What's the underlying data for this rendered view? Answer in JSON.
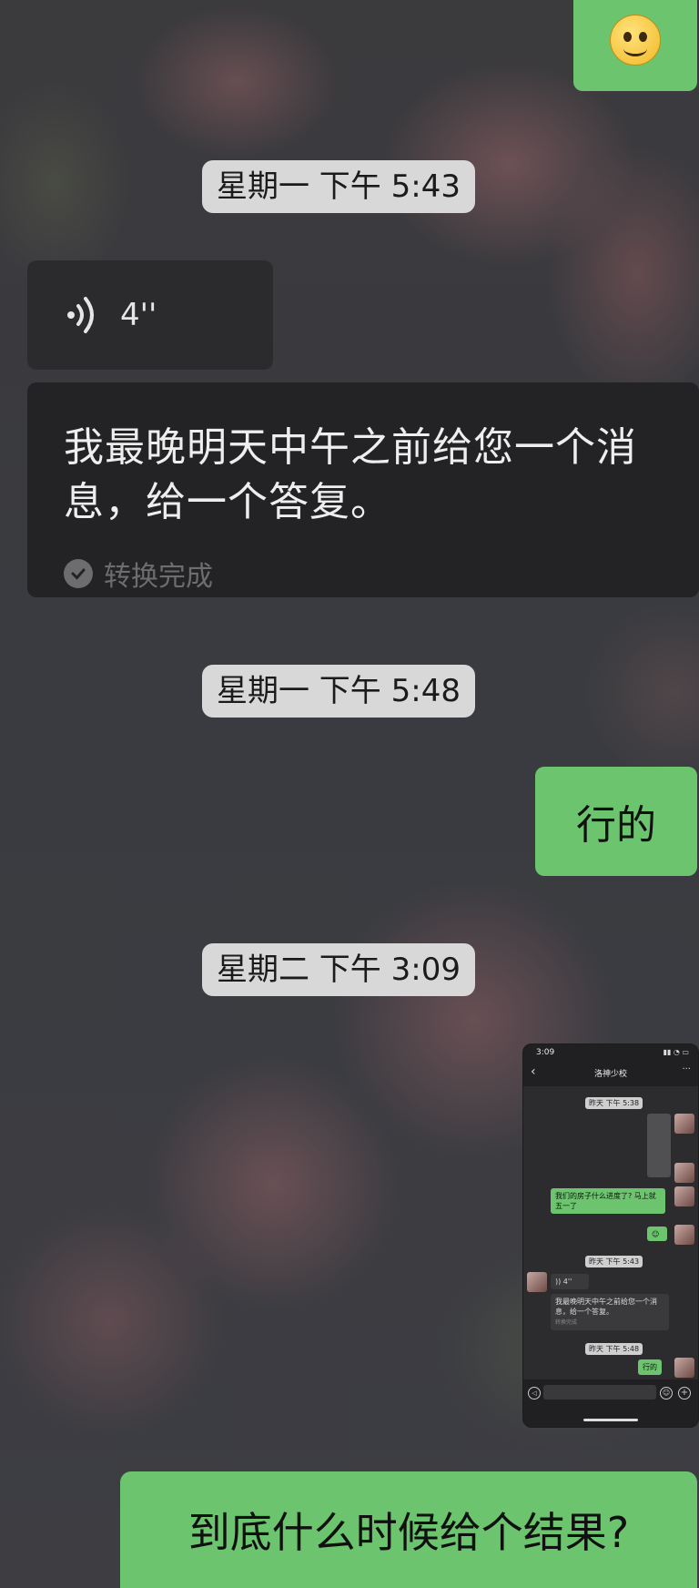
{
  "messages": {
    "emoji_top": "🙂",
    "timestamp_1": "星期一 下午 5:43",
    "voice_duration": "4''",
    "transcript_text": "我最晚明天中午之前给您一个消息，给一个答复。",
    "transcript_status": "转换完成",
    "timestamp_2": "星期一 下午 5:48",
    "reply_1": "行的",
    "timestamp_3": "星期二 下午 3:09",
    "last_message": "到底什么时候给个结果?"
  },
  "thumbnail": {
    "time": "3:09",
    "title": "洛神少校",
    "ts_1": "昨天 下午 5:38",
    "bubble_1": "我们的房子什么进度了? 马上就五一了",
    "ts_2": "昨天 下午 5:43",
    "voice": "4''",
    "transcript": "我最晚明天中午之前给您一个消息，给一个答复。",
    "status": "转换完成",
    "ts_3": "昨天 下午 5:48",
    "reply": "行的"
  }
}
